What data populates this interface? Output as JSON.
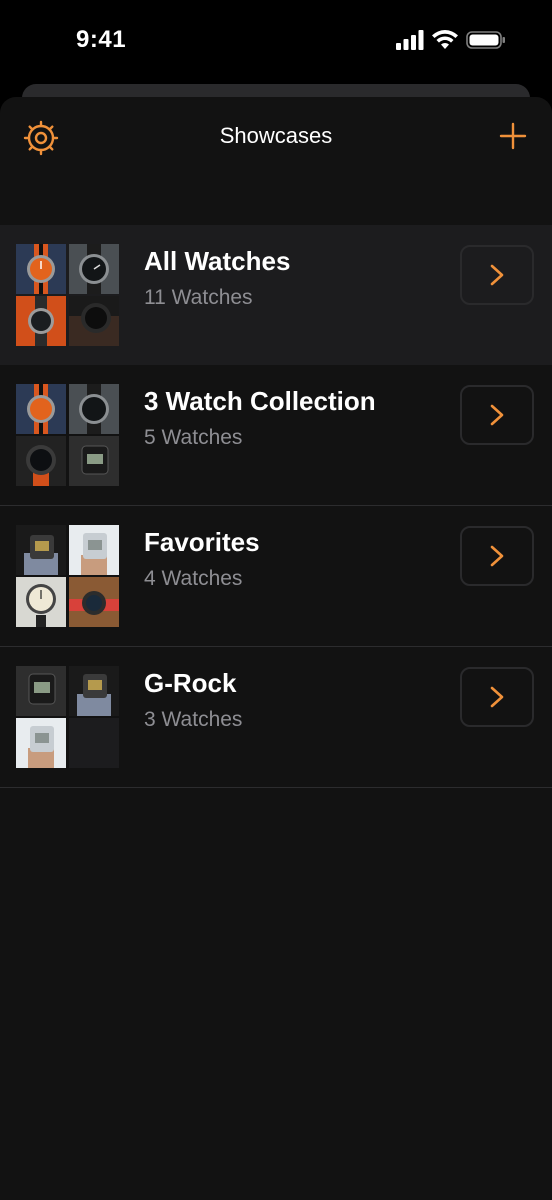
{
  "status_bar": {
    "time": "9:41",
    "icons": [
      "cellular-signal-icon",
      "wifi-icon",
      "battery-icon"
    ]
  },
  "nav": {
    "title": "Showcases",
    "left_icon": "gear-icon",
    "right_icon": "plus-icon"
  },
  "colors": {
    "accent": "#F0913A",
    "background": "#121212",
    "selected_row": "#1C1C1E",
    "secondary_text": "#8E8E93"
  },
  "showcases": [
    {
      "title": "All Watches",
      "count_label": "11 Watches",
      "thumbnails": [
        "watch-orange-dial",
        "watch-black-dial",
        "watch-black-on-orange",
        "watch-black-dive"
      ]
    },
    {
      "title": "3 Watch Collection",
      "count_label": "5 Watches",
      "thumbnails": [
        "watch-orange-dial",
        "watch-black-dial",
        "watch-black-dive-orange-strap",
        "watch-digital-black"
      ]
    },
    {
      "title": "Favorites",
      "count_label": "4 Watches",
      "thumbnails": [
        "watch-digital-gold",
        "watch-digital-silver",
        "watch-white-field",
        "watch-red-strap"
      ]
    },
    {
      "title": "G-Rock",
      "count_label": "3 Watches",
      "thumbnails": [
        "watch-digital-black",
        "watch-digital-gold",
        "watch-digital-silver"
      ]
    }
  ]
}
